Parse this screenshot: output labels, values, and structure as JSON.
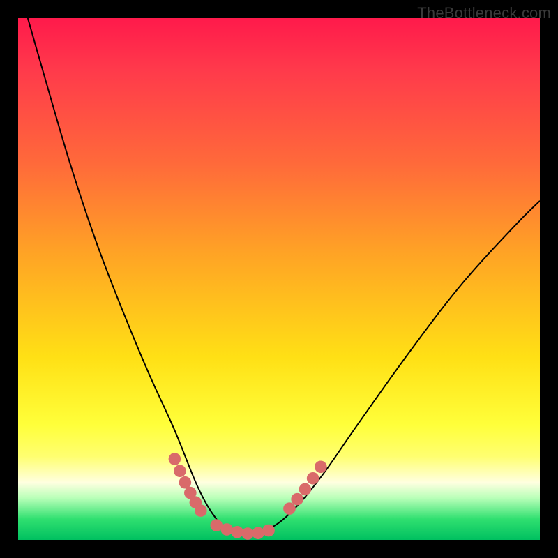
{
  "watermark": "TheBottleneck.com",
  "chart_data": {
    "type": "line",
    "title": "",
    "xlabel": "",
    "ylabel": "",
    "xlim": [
      0,
      1
    ],
    "ylim": [
      0,
      1
    ],
    "series": [
      {
        "name": "bottleneck-curve",
        "color": "#000000",
        "x": [
          0.0,
          0.05,
          0.1,
          0.15,
          0.2,
          0.25,
          0.3,
          0.345,
          0.38,
          0.41,
          0.44,
          0.47,
          0.52,
          0.58,
          0.65,
          0.75,
          0.85,
          0.95,
          1.0
        ],
        "y": [
          1.065,
          0.89,
          0.72,
          0.57,
          0.44,
          0.32,
          0.21,
          0.1,
          0.04,
          0.015,
          0.01,
          0.015,
          0.05,
          0.12,
          0.22,
          0.36,
          0.49,
          0.6,
          0.65
        ]
      },
      {
        "name": "highlight-dots-left",
        "color": "#d96a6a",
        "draw_as": "dots",
        "x": [
          0.3,
          0.31,
          0.32,
          0.33,
          0.34,
          0.35
        ],
        "y": [
          0.155,
          0.132,
          0.11,
          0.09,
          0.072,
          0.056
        ]
      },
      {
        "name": "highlight-dots-bottom",
        "color": "#d96a6a",
        "draw_as": "dots",
        "x": [
          0.38,
          0.4,
          0.42,
          0.44,
          0.46,
          0.48
        ],
        "y": [
          0.028,
          0.02,
          0.015,
          0.012,
          0.013,
          0.018
        ]
      },
      {
        "name": "highlight-dots-right",
        "color": "#d96a6a",
        "draw_as": "dots",
        "x": [
          0.52,
          0.535,
          0.55,
          0.565,
          0.58
        ],
        "y": [
          0.06,
          0.078,
          0.097,
          0.118,
          0.14
        ]
      }
    ]
  }
}
